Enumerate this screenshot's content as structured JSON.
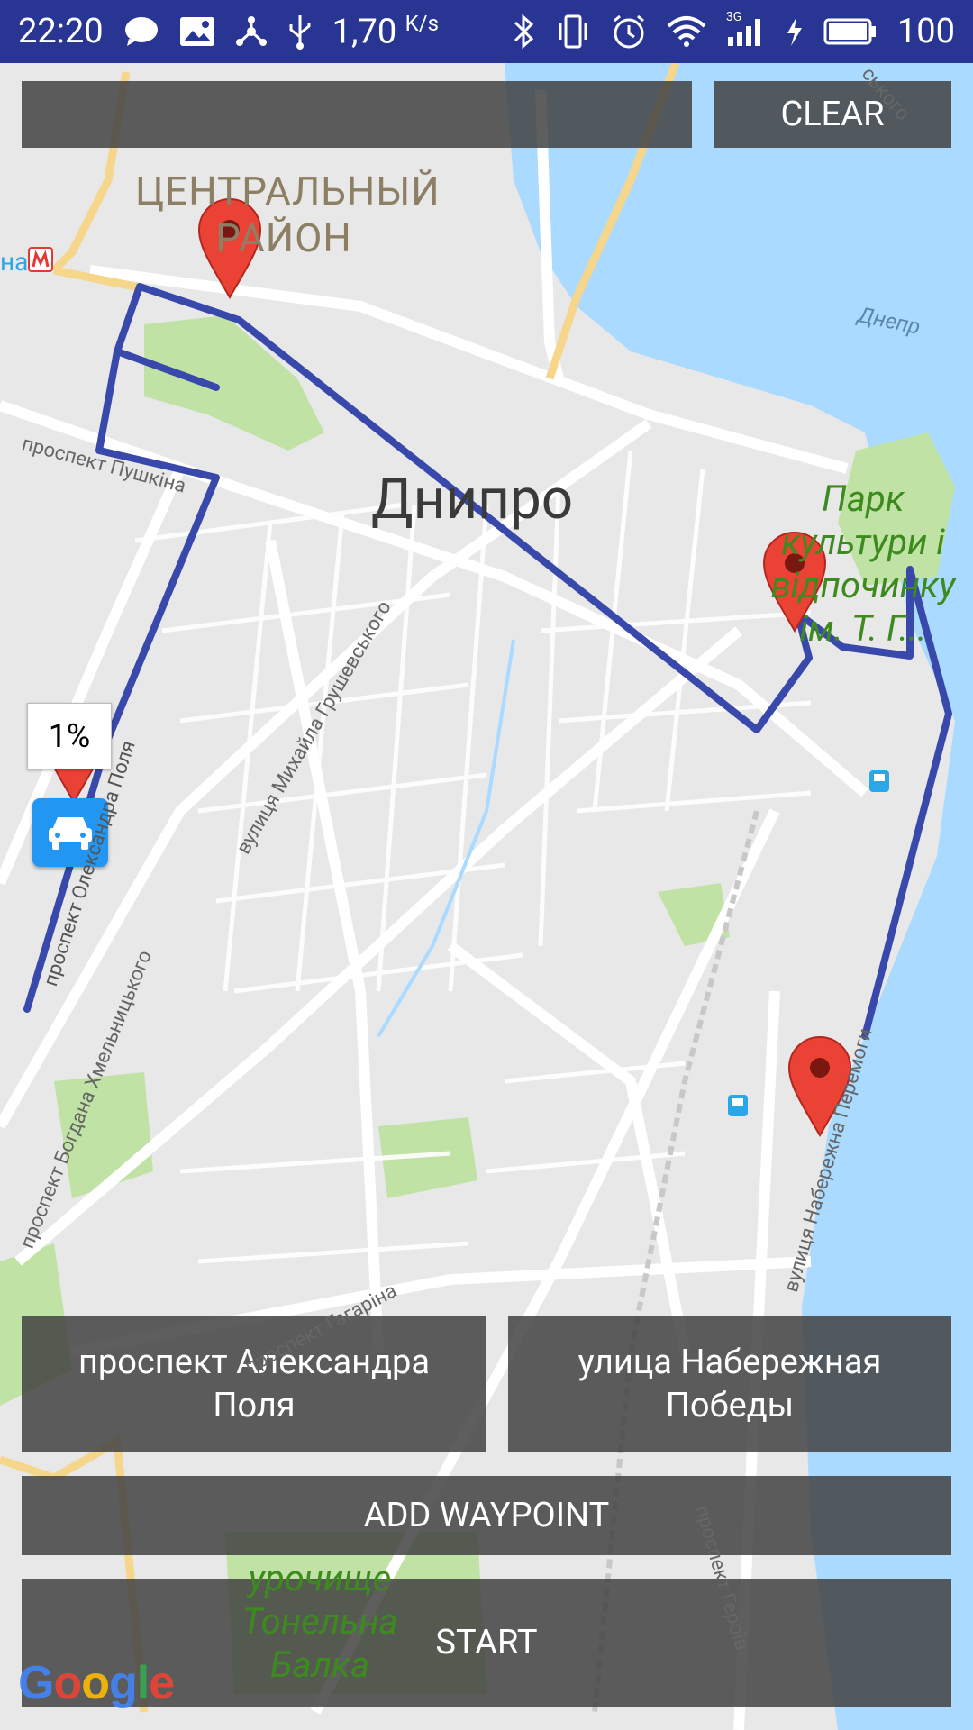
{
  "status_bar": {
    "time": "22:20",
    "net_speed_value": "1,70",
    "net_speed_unit": "K/s",
    "network_type": "3G",
    "battery": "100"
  },
  "top_bar": {
    "search_value": "",
    "clear_label": "CLEAR"
  },
  "map": {
    "labels": {
      "district_line1": "ЦЕНТРАЛЬНЫЙ",
      "district_line2": "РАЙОН",
      "city": "Днипро",
      "river": "Днепр",
      "park_line1": "Парк",
      "park_line2": "культури і",
      "park_line3": "відпочинку",
      "park_line4": "ім. Т. Г...",
      "street_pushkina": "проспект Пушкіна",
      "street_hrushevskoho": "вулиця Михайла Грушевського",
      "street_khmelnytskoho": "проспект Богдана Хмельницького",
      "street_naberezhna": "вулиця Набережна Перемоги",
      "street_hahrina": "проспект Гагаріна",
      "street_heroiv": "проспект Героїв",
      "street_poliа": "проспект Олександра Поля",
      "urochyshche_line1": "урочище",
      "urochyshche_line2": "Тонельна",
      "urochyshche_line3": "Балка",
      "metro_partial": "на",
      "top_partial": "ського"
    },
    "progress_percent": "1%"
  },
  "route": {
    "from_label": "проспект Александра Поля",
    "to_label": "улица Набережная Победы",
    "add_waypoint_label": "ADD WAYPOINT",
    "start_label": "START"
  },
  "colors": {
    "status_bar": "#283593",
    "route_line": "#3949ab",
    "water": "#aadaff",
    "park": "#c0e3a5",
    "marker": "#ea4335",
    "car_badge": "#2196f3"
  },
  "attribution": {
    "logo_letters": [
      "G",
      "o",
      "o",
      "g",
      "l",
      "e"
    ]
  }
}
